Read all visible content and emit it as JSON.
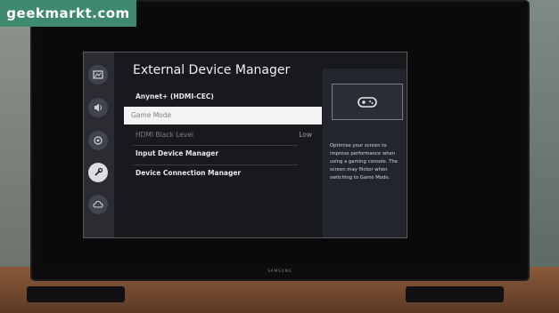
{
  "watermark": {
    "text": "geekmarkt.com"
  },
  "tv": {
    "brand": "SAMSUNG"
  },
  "menu": {
    "title": "External Device Manager",
    "categories": [
      {
        "icon": "picture-icon"
      },
      {
        "icon": "sound-icon"
      },
      {
        "icon": "connection-icon"
      },
      {
        "icon": "support-icon"
      },
      {
        "icon": "cloud-icon"
      }
    ],
    "items": [
      {
        "label": "Anynet+ (HDMI-CEC)",
        "value": ""
      },
      {
        "label": "Game Mode",
        "value": ""
      },
      {
        "label": "HDMI Black Level",
        "value": "Low"
      },
      {
        "label": "Input Device Manager",
        "value": ""
      },
      {
        "label": "Device Connection Manager",
        "value": ""
      }
    ]
  },
  "help": {
    "icon": "gamepad-icon",
    "text": "Optimise your screen to improve performance when using a gaming console. The screen may flicker when switching to Game Mode."
  }
}
